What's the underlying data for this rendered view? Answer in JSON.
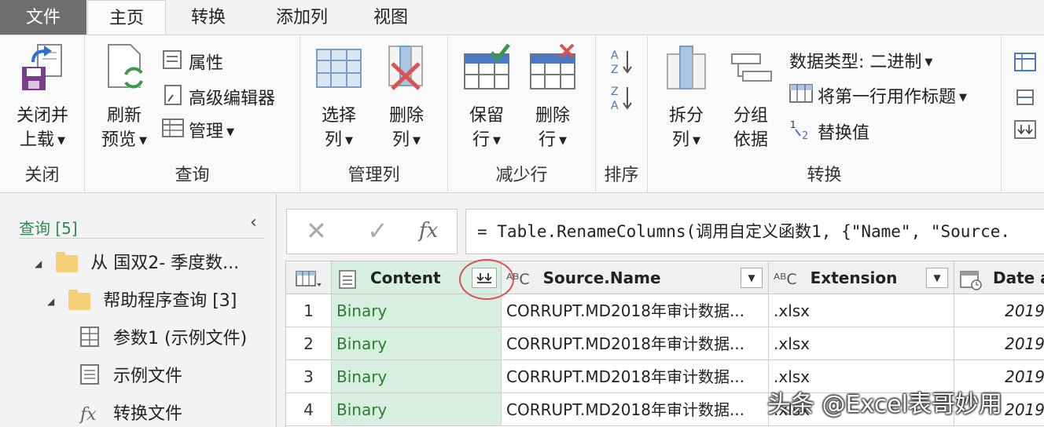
{
  "menu": {
    "tabs": [
      "文件",
      "主页",
      "转换",
      "添加列",
      "视图"
    ]
  },
  "ribbon": {
    "close_group": {
      "label": "关闭",
      "close_load": [
        "关闭并",
        "上载"
      ]
    },
    "query_group": {
      "label": "查询",
      "refresh": [
        "刷新",
        "预览"
      ],
      "properties": "属性",
      "advanced_editor": "高级编辑器",
      "manage": "管理"
    },
    "manage_cols_group": {
      "label": "管理列",
      "choose": [
        "选择",
        "列"
      ],
      "remove": [
        "删除",
        "列"
      ]
    },
    "reduce_rows_group": {
      "label": "减少行",
      "keep": [
        "保留",
        "行"
      ],
      "remove": [
        "删除",
        "行"
      ]
    },
    "sort_group": {
      "label": "排序"
    },
    "transform_group": {
      "label": "转换",
      "split": [
        "拆分",
        "列"
      ],
      "group_by": [
        "分组",
        "依据"
      ],
      "data_type": "数据类型: 二进制",
      "first_row_header": "将第一行用作标题",
      "replace_values": "替换值"
    }
  },
  "queries": {
    "header": "查询 [5]",
    "items": [
      {
        "label": "从 国双2- 季度数...",
        "kind": "folder"
      },
      {
        "label": "帮助程序查询 [3]",
        "kind": "folder"
      },
      {
        "label": "参数1 (示例文件)",
        "kind": "param"
      },
      {
        "label": "示例文件",
        "kind": "table"
      },
      {
        "label": "转换文件",
        "kind": "function"
      }
    ]
  },
  "formula": {
    "fx": "fx",
    "text": "= Table.RenameColumns(调用自定义函数1, {\"Name\", \"Source."
  },
  "grid": {
    "columns": [
      {
        "name": "Content",
        "type_icon": "table-icon"
      },
      {
        "name": "Source.Name",
        "type_icon": "ABC"
      },
      {
        "name": "Extension",
        "type_icon": "ABC"
      },
      {
        "name": "Date a",
        "type_icon": "calendar-icon"
      }
    ],
    "rows": [
      {
        "num": "1",
        "content": "Binary",
        "source": "CORRUPT.MD2018年审计数据...",
        "ext": ".xlsx",
        "date": "2019"
      },
      {
        "num": "2",
        "content": "Binary",
        "source": "CORRUPT.MD2018年审计数据...",
        "ext": ".xlsx",
        "date": "2019"
      },
      {
        "num": "3",
        "content": "Binary",
        "source": "CORRUPT.MD2018年审计数据...",
        "ext": ".xlsx",
        "date": "2019"
      },
      {
        "num": "4",
        "content": "Binary",
        "source": "CORRUPT.MD2018年审计数据...",
        "ext": ".xlsx",
        "date": "2019"
      }
    ]
  },
  "watermark": "头条 @Excel表哥妙用",
  "colors": {
    "selected_column": "#d6efe0",
    "binary_text": "#2e7d32",
    "highlight_circle": "#d9534f"
  }
}
